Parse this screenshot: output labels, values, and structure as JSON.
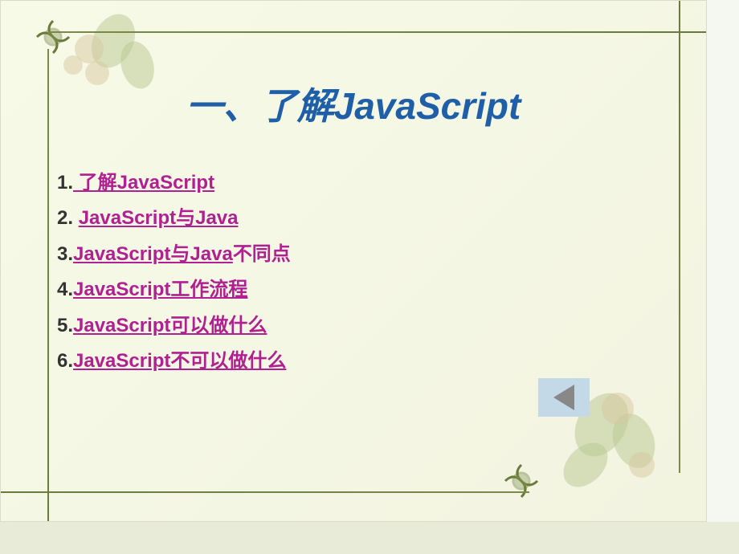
{
  "title": "一、了解JavaScript",
  "list_items": [
    {
      "number": "1.",
      "link": " 了解JavaScript",
      "trailing": ""
    },
    {
      "number": "2. ",
      "link": "JavaScript与Java",
      "trailing": ""
    },
    {
      "number": "3.",
      "link": "JavaScript与Java",
      "trailing": "不同点"
    },
    {
      "number": "4.",
      "link": "JavaScript工作流程",
      "trailing": ""
    },
    {
      "number": "5.",
      "link": "JavaScript可以做什么",
      "trailing": ""
    },
    {
      "number": "6.",
      "link": "JavaScript不可以做什么",
      "trailing": ""
    }
  ]
}
